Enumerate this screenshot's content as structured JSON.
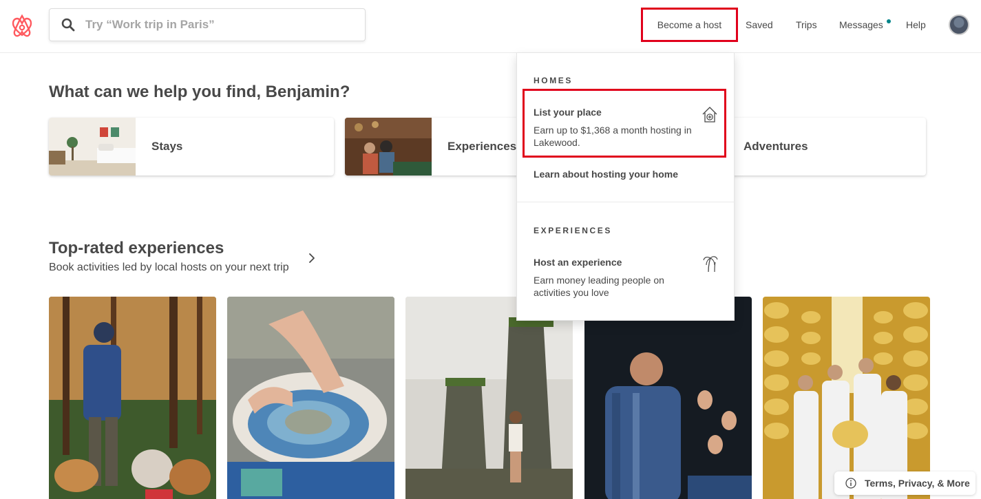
{
  "header": {
    "search": {
      "placeholder": "Try “Work trip in Paris”"
    },
    "nav": {
      "become_host": "Become a host",
      "saved": "Saved",
      "trips": "Trips",
      "messages": "Messages",
      "help": "Help"
    }
  },
  "main": {
    "greeting": "What can we help you find, Benjamin?",
    "categories": [
      {
        "label": "Stays"
      },
      {
        "label": "Experiences"
      },
      {
        "label": "Adventures"
      }
    ],
    "section": {
      "title": "Top-rated experiences",
      "subtitle": "Book activities led by local hosts on your next trip"
    }
  },
  "dropdown": {
    "homes_heading": "HOMES",
    "list_place_title": "List your place",
    "list_place_desc": "Earn up to $1,368 a month hosting in Lakewood.",
    "learn_hosting": "Learn about hosting your home",
    "experiences_heading": "EXPERIENCES",
    "host_experience_title": "Host an experience",
    "host_experience_desc": "Earn money leading people on activities you love"
  },
  "footer": {
    "terms": "Terms, Privacy, & More"
  },
  "colors": {
    "brand": "#FF5A5F",
    "highlight": "#E0001B",
    "dot": "#008489",
    "text": "#484848"
  },
  "icons": [
    "airbnb-logo-icon",
    "search-icon",
    "chevron-right-icon",
    "house-plus-icon",
    "palm-tree-icon",
    "info-icon"
  ]
}
